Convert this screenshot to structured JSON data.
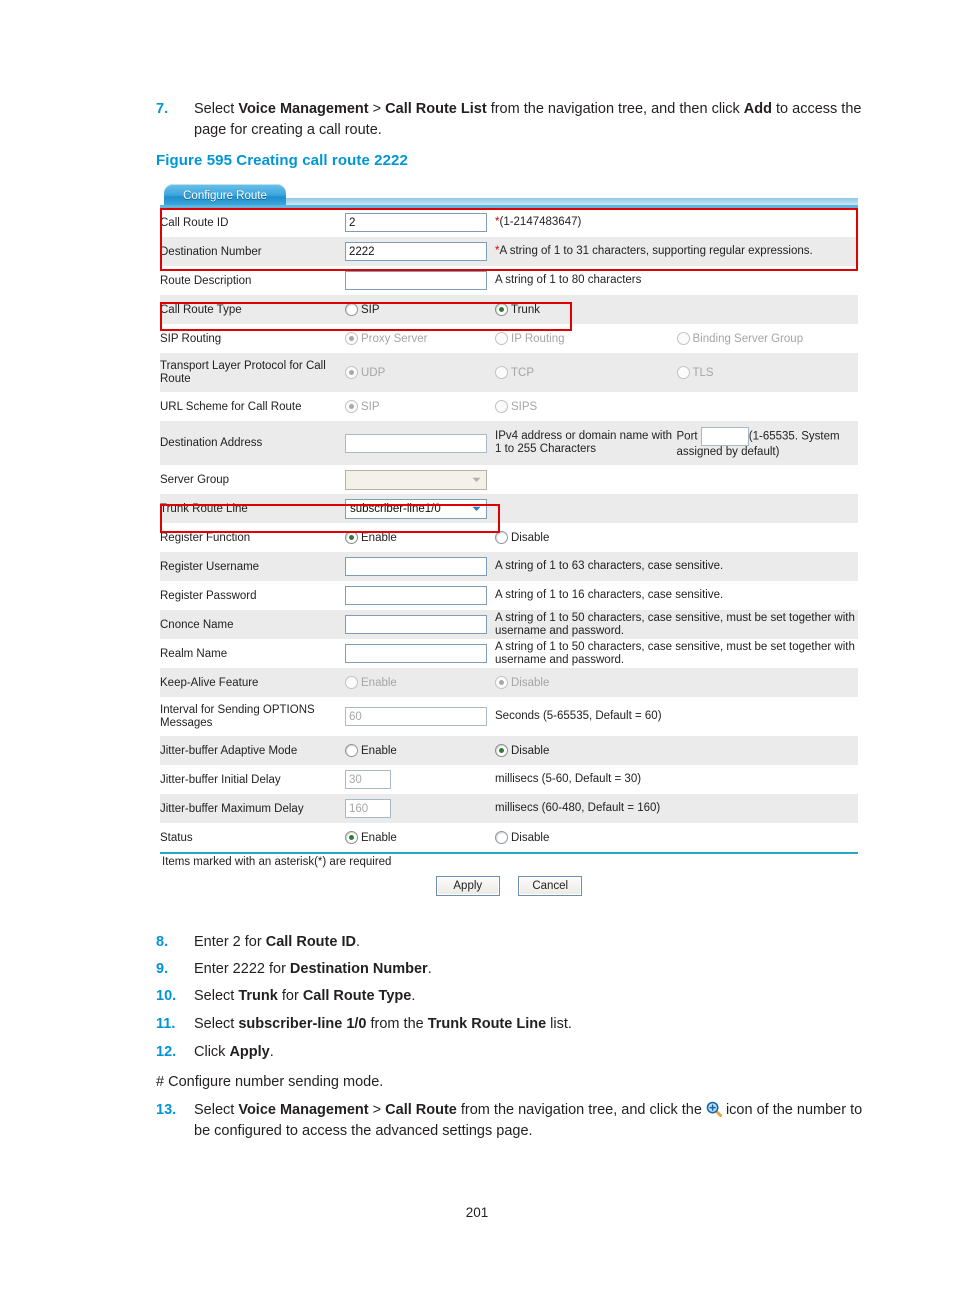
{
  "doc": {
    "step7": {
      "num": "7.",
      "parts": [
        {
          "t": "Select ",
          "b": false
        },
        {
          "t": "Voice Management",
          "b": true
        },
        {
          "t": " > ",
          "b": false
        },
        {
          "t": "Call Route List",
          "b": true
        },
        {
          "t": " from the navigation tree, and then click ",
          "b": false
        },
        {
          "t": "Add",
          "b": true
        },
        {
          "t": " to access the page for creating a call route.",
          "b": false
        }
      ]
    },
    "figure_title": "Figure 595 Creating call route 2222",
    "step8": {
      "num": "8.",
      "parts": [
        {
          "t": "Enter 2 for ",
          "b": false
        },
        {
          "t": "Call Route ID",
          "b": true
        },
        {
          "t": ".",
          "b": false
        }
      ]
    },
    "step9": {
      "num": "9.",
      "parts": [
        {
          "t": "Enter 2222 for ",
          "b": false
        },
        {
          "t": "Destination Number",
          "b": true
        },
        {
          "t": ".",
          "b": false
        }
      ]
    },
    "step10": {
      "num": "10.",
      "parts": [
        {
          "t": "Select ",
          "b": false
        },
        {
          "t": "Trunk",
          "b": true
        },
        {
          "t": " for ",
          "b": false
        },
        {
          "t": "Call Route Type",
          "b": true
        },
        {
          "t": ".",
          "b": false
        }
      ]
    },
    "step11": {
      "num": "11.",
      "parts": [
        {
          "t": "Select ",
          "b": false
        },
        {
          "t": "subscriber-line 1/0",
          "b": true
        },
        {
          "t": " from the ",
          "b": false
        },
        {
          "t": "Trunk Route Line",
          "b": true
        },
        {
          "t": " list.",
          "b": false
        }
      ]
    },
    "step12": {
      "num": "12.",
      "parts": [
        {
          "t": "Click ",
          "b": false
        },
        {
          "t": "Apply",
          "b": true
        },
        {
          "t": ".",
          "b": false
        }
      ]
    },
    "comment": "# Configure number sending mode.",
    "step13": {
      "num": "13.",
      "parts": [
        {
          "t": "Select ",
          "b": false
        },
        {
          "t": "Voice Management",
          "b": true
        },
        {
          "t": " > ",
          "b": false
        },
        {
          "t": "Call Route",
          "b": true
        },
        {
          "t": " from the navigation tree, and click the ",
          "b": false
        },
        {
          "t": "[zoom-in-icon]",
          "icon": "zoom-in-icon"
        },
        {
          "t": " icon of the number to be configured to access the advanced settings page.",
          "b": false
        }
      ]
    },
    "page_number": "201"
  },
  "screenshot": {
    "tab": {
      "label": "Configure Route"
    },
    "rows": [
      {
        "label": "Call Route ID",
        "control": "text",
        "value": "2",
        "hint": "*(1-2147483647)",
        "required": true,
        "disabled": false
      },
      {
        "label": "Destination Number",
        "control": "text",
        "value": "2222",
        "hint": "*A string of 1 to 31 characters, supporting regular expressions.",
        "required": true,
        "disabled": false
      },
      {
        "label": "Route Description",
        "control": "text",
        "value": "",
        "hint": "A string of 1 to 80 characters",
        "required": false,
        "disabled": false
      },
      {
        "label": "Call Route Type",
        "control": "radio2",
        "options": [
          "SIP",
          "Trunk"
        ],
        "selected": 1,
        "disabled": false
      },
      {
        "label": "SIP Routing",
        "control": "radio3",
        "options": [
          "Proxy Server",
          "IP Routing",
          "Binding Server Group"
        ],
        "selected": 0,
        "disabled": true
      },
      {
        "label": "Transport Layer Protocol for Call Route",
        "control": "radio3",
        "options": [
          "UDP",
          "TCP",
          "TLS"
        ],
        "selected": 0,
        "disabled": true
      },
      {
        "label": "URL Scheme for Call Route",
        "control": "radio2",
        "options": [
          "SIP",
          "SIPS"
        ],
        "selected": 0,
        "disabled": true
      },
      {
        "label": "Destination Address",
        "control": "address",
        "value": "",
        "hint": "IPv4 address or domain name with 1 to 255 Characters",
        "port_label": "Port",
        "port_value": "",
        "port_hint": "(1-65535. System assigned by default)",
        "disabled": true
      },
      {
        "label": "Server Group",
        "control": "select",
        "value": "",
        "disabled": true
      },
      {
        "label": "Trunk Route Line",
        "control": "select",
        "value": "subscriber-line1/0",
        "disabled": false
      },
      {
        "label": "Register Function",
        "control": "radio2",
        "options": [
          "Enable",
          "Disable"
        ],
        "selected": 0,
        "disabled": false
      },
      {
        "label": "Register Username",
        "control": "text",
        "value": "",
        "hint": "A string of 1 to 63 characters, case sensitive.",
        "disabled": false
      },
      {
        "label": "Register Password",
        "control": "text",
        "value": "",
        "hint": "A string of 1 to 16 characters, case sensitive.",
        "disabled": false
      },
      {
        "label": "Cnonce Name",
        "control": "text",
        "value": "",
        "hint": "A string of 1 to 50 characters, case sensitive, must be set together with username and password.",
        "disabled": false
      },
      {
        "label": "Realm Name",
        "control": "text",
        "value": "",
        "hint": "A string of 1 to 50 characters, case sensitive, must be set together with username and password.",
        "disabled": false
      },
      {
        "label": "Keep-Alive Feature",
        "control": "radio2",
        "options": [
          "Enable",
          "Disable"
        ],
        "selected": 1,
        "disabled": true
      },
      {
        "label": "Interval for Sending OPTIONS Messages",
        "control": "text",
        "value": "60",
        "hint": "Seconds (5-65535, Default = 60)",
        "disabled": true
      },
      {
        "label": "Jitter-buffer Adaptive Mode",
        "control": "radio2",
        "options": [
          "Enable",
          "Disable"
        ],
        "selected": 1,
        "disabled": false
      },
      {
        "label": "Jitter-buffer Initial Delay",
        "control": "text-sm",
        "value": "30",
        "hint": "millisecs (5-60, Default = 30)",
        "disabled": true
      },
      {
        "label": "Jitter-buffer Maximum Delay",
        "control": "text-sm",
        "value": "160",
        "hint": "millisecs (60-480, Default = 160)",
        "disabled": true
      },
      {
        "label": "Status",
        "control": "radio2",
        "options": [
          "Enable",
          "Disable"
        ],
        "selected": 0,
        "disabled": false
      }
    ],
    "footer_note": "Items marked with an asterisk(*) are required",
    "buttons": {
      "apply": "Apply",
      "cancel": "Cancel"
    }
  }
}
